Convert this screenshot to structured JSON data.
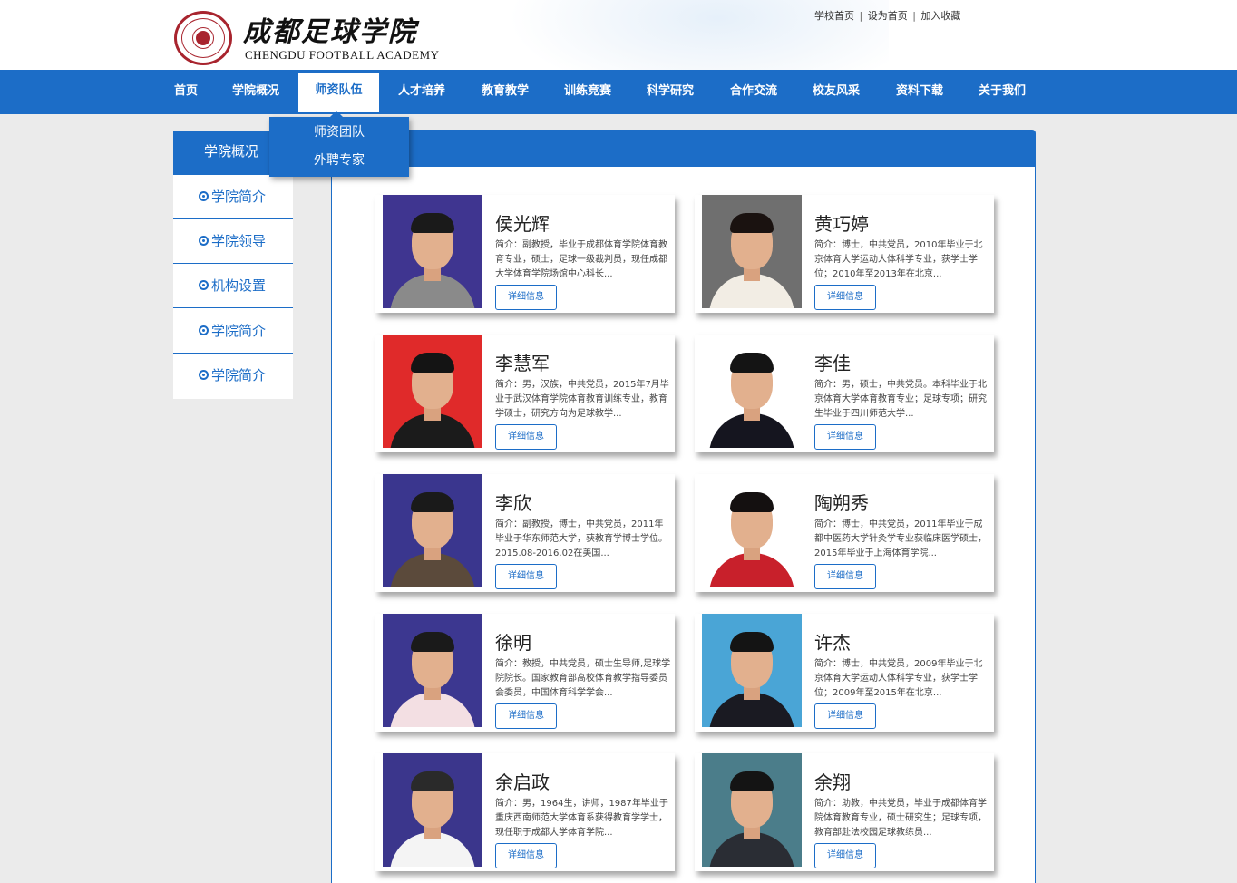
{
  "header": {
    "logo_cn": "成都足球学院",
    "logo_en": "CHENGDU FOOTBALL ACADEMY",
    "toplinks": [
      "学校首页",
      "设为首页",
      "加入收藏"
    ],
    "toplinks_sep": "|"
  },
  "nav": {
    "items": [
      "首页",
      "学院概况",
      "师资队伍",
      "人才培养",
      "教育教学",
      "训练竞赛",
      "科学研究",
      "合作交流",
      "校友风采",
      "资料下载",
      "关于我们"
    ],
    "active": "师资队伍"
  },
  "dropdown": {
    "items": [
      "师资团队",
      "外聘专家"
    ]
  },
  "sidebar": {
    "title": "学院概况",
    "items": [
      "学院简介",
      "学院领导",
      "机构设置",
      "学院简介",
      "学院简介"
    ]
  },
  "detail_label": "详细信息",
  "teachers": [
    {
      "name": "侯光辉",
      "intro": "简介：副教授，毕业于成都体育学院体育教育专业，硕士，足球一级裁判员，现任成都大学体育学院场馆中心科长...",
      "photo_bg": "#3f3590",
      "clothes": "#8a8a8a",
      "hair": "#1a1a1a"
    },
    {
      "name": "黄巧婷",
      "intro": "简介：博士，中共党员，2010年毕业于北京体育大学运动人体科学专业，获学士学位；2010年至2013年在北京...",
      "photo_bg": "#6f6f6f",
      "clothes": "#f2ede4",
      "hair": "#1a1210"
    },
    {
      "name": "李慧军",
      "intro": "简介：男，汉族，中共党员，2015年7月毕业于武汉体育学院体育教育训练专业，教育学硕士，研究方向为足球教学...",
      "photo_bg": "#e02a2a",
      "clothes": "#1b1b1b",
      "hair": "#141414"
    },
    {
      "name": "李佳",
      "intro": "简介：男，硕士，中共党员。本科毕业于北京体育大学体育教育专业；足球专项；研究生毕业于四川师范大学...",
      "photo_bg": "#ffffff",
      "clothes": "#15151f",
      "hair": "#141414"
    },
    {
      "name": "李欣",
      "intro": "简介：副教授，博士，中共党员，2011年毕业于华东师范大学，获教育学博士学位。2015.08-2016.02在美国...",
      "photo_bg": "#3a368e",
      "clothes": "#5b4a3b",
      "hair": "#1a1a1a"
    },
    {
      "name": "陶朔秀",
      "intro": "简介：博士，中共党员，2011年毕业于成都中医药大学针灸学专业获临床医学硕士，2015年毕业于上海体育学院...",
      "photo_bg": "#ffffff",
      "clothes": "#c8202b",
      "hair": "#141010"
    },
    {
      "name": "徐明",
      "intro": "简介：教授，中共党员，硕士生导师,足球学院院长。国家教育部高校体育教学指导委员会委员，中国体育科学学会...",
      "photo_bg": "#3c3790",
      "clothes": "#f3dfe3",
      "hair": "#1a1a1a"
    },
    {
      "name": "许杰",
      "intro": "简介：博士，中共党员，2009年毕业于北京体育大学运动人体科学专业，获学士学位；2009年至2015年在北京...",
      "photo_bg": "#4aa5d6",
      "clothes": "#1a1a22",
      "hair": "#141414"
    },
    {
      "name": "余启政",
      "intro": "简介：男，1964生，讲师，1987年毕业于重庆西南师范大学体育系获得教育学学士，现任职于成都大学体育学院...",
      "photo_bg": "#3b368c",
      "clothes": "#f4f4f4",
      "hair": "#2a2a2a"
    },
    {
      "name": "余翔",
      "intro": "简介：助教，中共党员，毕业于成都体育学院体育教育专业，硕士研究生；足球专项，教育部赴法校园足球教练员...",
      "photo_bg": "#4b7d8a",
      "clothes": "#2a2d34",
      "hair": "#141414"
    }
  ]
}
